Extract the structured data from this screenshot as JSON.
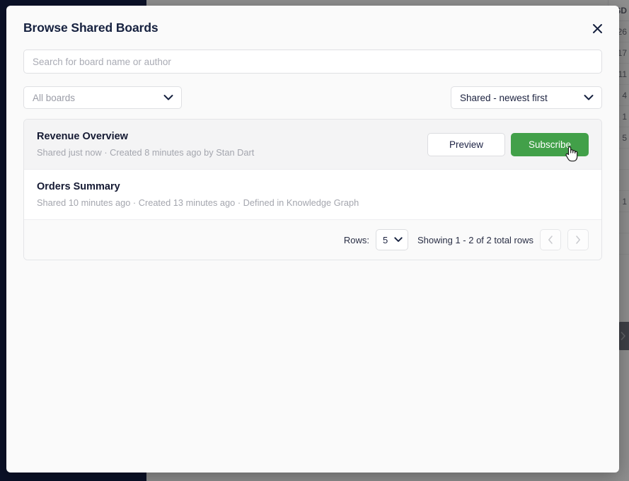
{
  "modal": {
    "title": "Browse Shared Boards",
    "close_icon": "close-icon",
    "search": {
      "placeholder": "Search for board name or author",
      "value": ""
    },
    "filters": {
      "boards": {
        "selected": "All boards",
        "caret_icon": "chevron-down-icon"
      },
      "sort": {
        "selected": "Shared - newest first",
        "caret_icon": "chevron-down-icon"
      }
    },
    "boards": [
      {
        "name": "Revenue Overview",
        "meta": "Shared just now  ·  Created 8 minutes ago by Stan Dart",
        "preview_label": "Preview",
        "subscribe_label": "Subscribe",
        "highlighted": true
      },
      {
        "name": "Orders Summary",
        "meta": "Shared 10 minutes ago  ·  Created 13 minutes ago  ·  Defined in Knowledge Graph",
        "highlighted": false
      }
    ],
    "pagination": {
      "rows_label": "Rows:",
      "rows_value": "5",
      "showing_text": "Showing 1 - 2 of 2 total rows",
      "prev_icon": "chevron-left-icon",
      "next_icon": "chevron-right-icon"
    }
  },
  "background": {
    "table": {
      "header": "SD",
      "values": [
        "26",
        "17",
        "11",
        "4",
        "1",
        "5",
        "",
        "",
        "1",
        "",
        ""
      ]
    },
    "panel_tab_icon": "chevron-right-icon"
  },
  "colors": {
    "accent_green": "#42a049",
    "navy": "#16213f",
    "sidebar_navy": "#060d26",
    "muted_text": "#a4a6ae",
    "modal_bg": "#fafafa"
  },
  "cursor": {
    "icon": "pointing-hand-cursor"
  }
}
